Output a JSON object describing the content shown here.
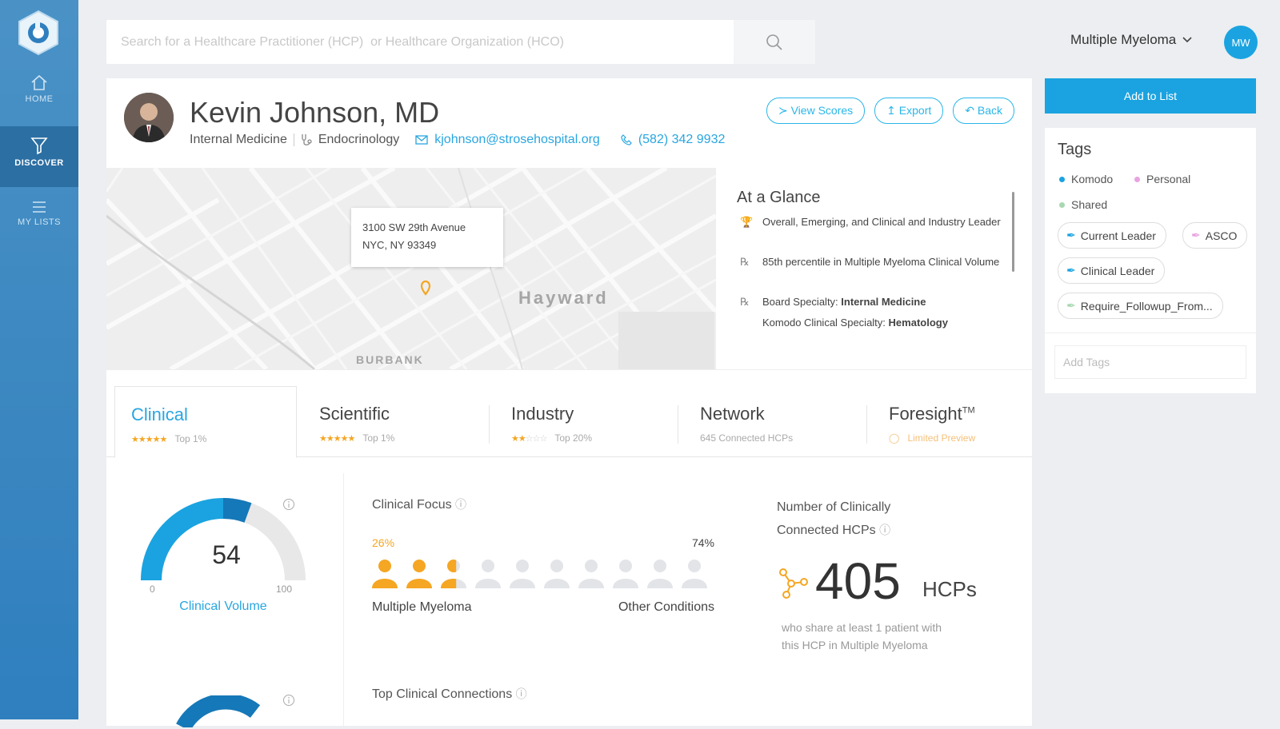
{
  "nav": {
    "items": [
      {
        "label": "HOME",
        "icon": "home-icon"
      },
      {
        "label": "DISCOVER",
        "icon": "filter-icon",
        "active": true
      },
      {
        "label": "MY LISTS",
        "icon": "list-icon"
      }
    ]
  },
  "search": {
    "placeholder": "Search for a Healthcare Practitioner (HCP)  or Healthcare Organization (HCO)"
  },
  "header": {
    "disease_selector": "Multiple Myeloma",
    "avatar_initials": "MW"
  },
  "profile": {
    "name": "Kevin Johnson, MD",
    "specialty": "Internal Medicine",
    "subspecialty": "Endocrinology",
    "email": "kjohnson@strosehospital.org",
    "phone": "(582) 342 9932",
    "buttons": {
      "view_scores": "View Scores",
      "export": "Export",
      "back": "Back"
    }
  },
  "map": {
    "address_line1": "3100 SW 29th Avenue",
    "address_line2": "NYC, NY 93349",
    "city_label": "Hayward",
    "district_label": "BURBANK"
  },
  "glance": {
    "title": "At a Glance",
    "row1": "Overall, Emerging, and Clinical and Industry Leader",
    "row2": "85th percentile in Multiple Myeloma Clinical Volume",
    "row3_prefix": "Board Specialty: ",
    "row3_value": "Internal Medicine",
    "row4_prefix": "Komodo Clinical Specialty: ",
    "row4_value": "Hematology"
  },
  "tabs": [
    {
      "label": "Clinical",
      "sub": "Top 1%",
      "stars": 5
    },
    {
      "label": "Scientific",
      "sub": "Top 1%",
      "stars": 5
    },
    {
      "label": "Industry",
      "sub": "Top 20%",
      "stars": 2
    },
    {
      "label": "Network",
      "sub": "645 Connected HCPs"
    },
    {
      "label": "Foresight",
      "sup": "TM",
      "sub": "Limited Preview"
    }
  ],
  "clinical_volume": {
    "value": "54",
    "min": "0",
    "max": "100",
    "label": "Clinical Volume",
    "fraction": 0.54
  },
  "clinical_focus": {
    "title": "Clinical Focus",
    "left_pct": "26%",
    "right_pct": "74%",
    "left_label": "Multiple Myeloma",
    "right_label": "Other Conditions"
  },
  "connected": {
    "title_line1": "Number of Clinically",
    "title_line2": "Connected HCPs",
    "count": "405",
    "unit": "HCPs",
    "desc_line1": "who share at least 1 patient with",
    "desc_line2": "this HCP in Multiple Myeloma"
  },
  "top_connections": {
    "title": "Top Clinical Connections"
  },
  "sidebar_right": {
    "add_to_list": "Add to List",
    "tags_title": "Tags",
    "legend": [
      {
        "label": "Komodo",
        "color": "#1aa3e0"
      },
      {
        "label": "Personal",
        "color": "#e8a3e0"
      },
      {
        "label": "Shared",
        "color": "#a8d8b0"
      }
    ],
    "tags": [
      "Current Leader",
      "ASCO",
      "Clinical Leader",
      "Require_Followup_From..."
    ],
    "add_tags_placeholder": "Add Tags"
  },
  "colors": {
    "accent": "#1aa3e0",
    "orange": "#f5a623",
    "sidebar": "#3a86c0"
  }
}
